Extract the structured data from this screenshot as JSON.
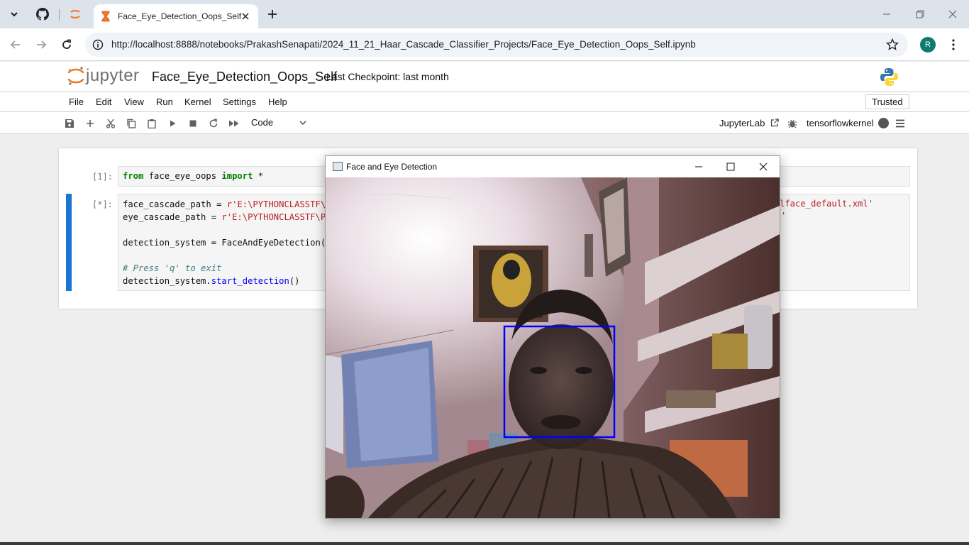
{
  "browser": {
    "tab": {
      "title": "Face_Eye_Detection_Oops_Self"
    },
    "url": "http://localhost:8888/notebooks/PrakashSenapati/2024_11_21_Haar_Cascade_Classifier_Projects/Face_Eye_Detection_Oops_Self.ipynb",
    "profile_initial": "R"
  },
  "jupyter": {
    "logo_text": "jupyter",
    "notebook_title": "Face_Eye_Detection_Oops_Self",
    "checkpoint": "Last Checkpoint: last month",
    "menu": [
      "File",
      "Edit",
      "View",
      "Run",
      "Kernel",
      "Settings",
      "Help"
    ],
    "trusted": "Trusted",
    "cell_type": "Code",
    "jupyterlab_link": "JupyterLab",
    "kernel_name": "tensorflowkernel"
  },
  "cells": [
    {
      "prompt": "[1]:",
      "lines": [
        [
          {
            "t": "from",
            "c": "kw"
          },
          {
            "t": " face_eye_oops ",
            "c": ""
          },
          {
            "t": "import",
            "c": "kw"
          },
          {
            "t": " *",
            "c": ""
          }
        ]
      ]
    },
    {
      "prompt": "[*]:",
      "lines": [
        [
          {
            "t": "face_cascade_path = ",
            "c": ""
          },
          {
            "t": "r'E:\\PYTHONCLASSTF\\P",
            "c": "str"
          }
        ],
        [
          {
            "t": "eye_cascade_path = ",
            "c": ""
          },
          {
            "t": "r'E:\\PYTHONCLASSTF\\Pr",
            "c": "str"
          }
        ],
        [
          {
            "t": "",
            "c": ""
          }
        ],
        [
          {
            "t": "detection_system = FaceAndEyeDetection(f",
            "c": ""
          }
        ],
        [
          {
            "t": "",
            "c": ""
          }
        ],
        [
          {
            "t": "# Press 'q' to exit",
            "c": "cm"
          }
        ],
        [
          {
            "t": "detection_system.",
            "c": ""
          },
          {
            "t": "start_detection",
            "c": "fn"
          },
          {
            "t": "()",
            "c": ""
          }
        ]
      ],
      "right_fragments": [
        "lface_default.xml'",
        "'"
      ]
    }
  ],
  "cv_window": {
    "title": "Face and Eye Detection"
  },
  "colors": {
    "accent": "#1976d2",
    "jupyter_orange": "#f37726",
    "face_box": "#0000ff"
  }
}
